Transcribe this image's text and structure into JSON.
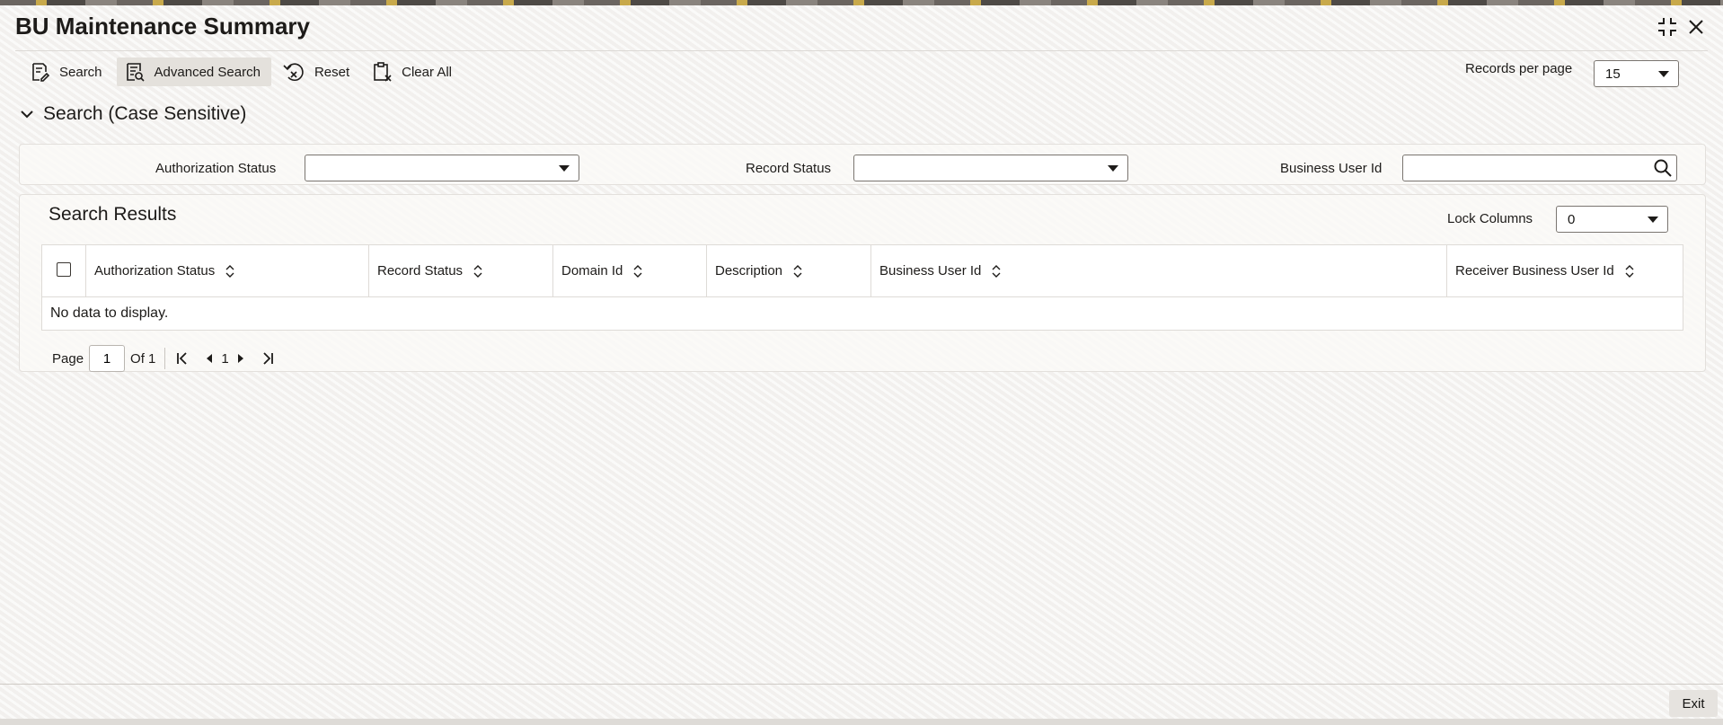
{
  "window": {
    "title": "BU Maintenance Summary"
  },
  "toolbar": {
    "search_label": "Search",
    "advanced_search_label": "Advanced Search",
    "reset_label": "Reset",
    "clear_all_label": "Clear All"
  },
  "records_per_page": {
    "label": "Records per page",
    "value": "15"
  },
  "search_section": {
    "title": "Search (Case Sensitive)",
    "authorization_status_label": "Authorization Status",
    "authorization_status_value": "",
    "record_status_label": "Record Status",
    "record_status_value": "",
    "business_user_id_label": "Business User Id",
    "business_user_id_value": ""
  },
  "results": {
    "title": "Search Results",
    "lock_columns_label": "Lock Columns",
    "lock_columns_value": "0",
    "columns": [
      "Authorization Status",
      "Record Status",
      "Domain Id",
      "Description",
      "Business User Id",
      "Receiver Business User Id"
    ],
    "empty_text": "No data to display."
  },
  "pagination": {
    "page_label": "Page",
    "current_page": "1",
    "of_label": "Of 1",
    "page_number": "1"
  },
  "footer": {
    "exit_label": "Exit"
  }
}
